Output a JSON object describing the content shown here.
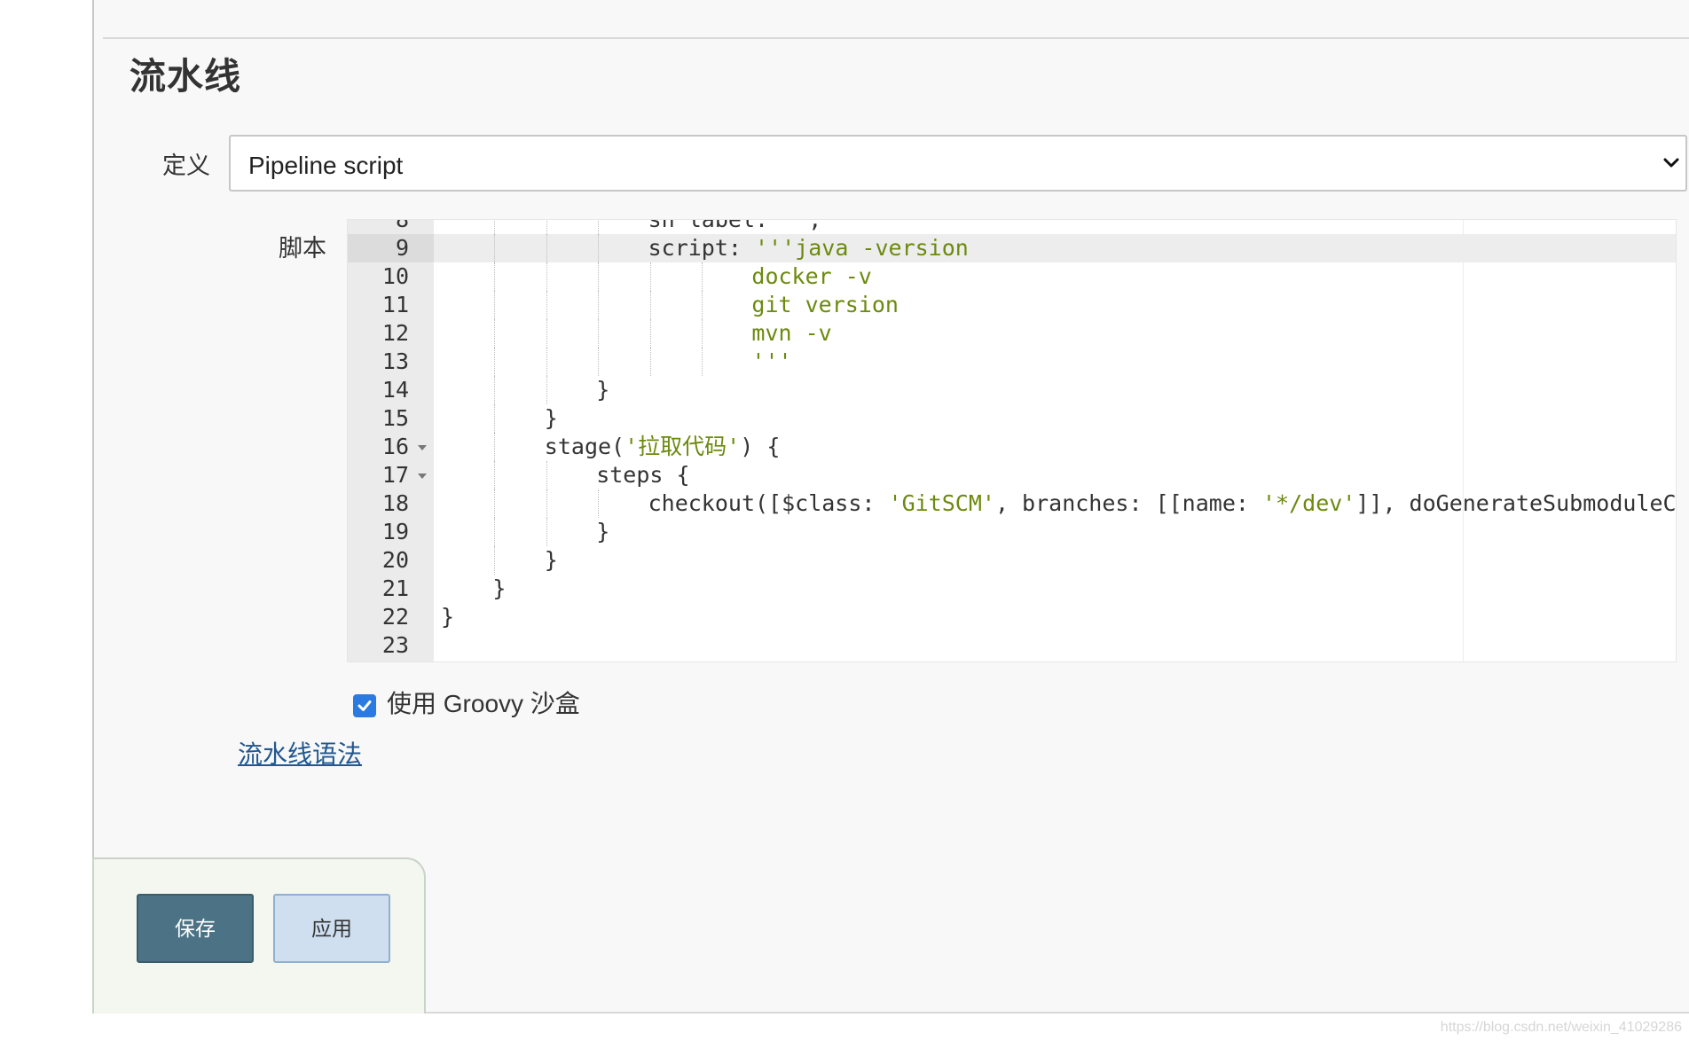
{
  "section": {
    "title": "流水线"
  },
  "definition": {
    "label": "定义",
    "selected": "Pipeline script"
  },
  "script": {
    "label": "脚本",
    "lines": [
      {
        "n": "8",
        "indent": 0,
        "guides": [
          3,
          4,
          5
        ],
        "parts": [
          [
            "sh label: '',",
            ""
          ]
        ],
        "fold": false,
        "partial": true
      },
      {
        "n": "9",
        "indent": 0,
        "guides": [
          3,
          4,
          5
        ],
        "parts": [
          [
            "script: ",
            ""
          ],
          [
            "'''java -version",
            "str"
          ]
        ],
        "fold": false,
        "active": true
      },
      {
        "n": "10",
        "indent": 0,
        "guides": [
          3,
          4,
          5,
          6,
          7
        ],
        "parts": [
          [
            "docker -v",
            "str"
          ]
        ],
        "fold": false
      },
      {
        "n": "11",
        "indent": 0,
        "guides": [
          3,
          4,
          5,
          6,
          7
        ],
        "parts": [
          [
            "git version",
            "str"
          ]
        ],
        "fold": false
      },
      {
        "n": "12",
        "indent": 0,
        "guides": [
          3,
          4,
          5,
          6,
          7
        ],
        "parts": [
          [
            "mvn -v",
            "str"
          ]
        ],
        "fold": false
      },
      {
        "n": "13",
        "indent": 0,
        "guides": [
          3,
          4,
          5,
          6,
          7
        ],
        "parts": [
          [
            "'''",
            "str"
          ]
        ],
        "fold": false
      },
      {
        "n": "14",
        "indent": 0,
        "guides": [
          3,
          4
        ],
        "parts": [
          [
            "}",
            ""
          ]
        ],
        "fold": false
      },
      {
        "n": "15",
        "indent": 0,
        "guides": [
          3
        ],
        "parts": [
          [
            "}",
            ""
          ]
        ],
        "fold": false
      },
      {
        "n": "16",
        "indent": 0,
        "guides": [
          3
        ],
        "parts": [
          [
            "stage(",
            ""
          ],
          [
            "'拉取代码'",
            "str"
          ],
          [
            ") {",
            ""
          ]
        ],
        "fold": true
      },
      {
        "n": "17",
        "indent": 0,
        "guides": [
          3,
          4
        ],
        "parts": [
          [
            "steps {",
            ""
          ]
        ],
        "fold": true
      },
      {
        "n": "18",
        "indent": 0,
        "guides": [
          3,
          4,
          5
        ],
        "parts": [
          [
            "checkout([$class: ",
            ""
          ],
          [
            "'GitSCM'",
            "str"
          ],
          [
            ", branches: [[name: ",
            ""
          ],
          [
            "'*/dev'",
            "str"
          ],
          [
            "]], doGenerateSubmoduleConfi",
            ""
          ]
        ],
        "fold": false
      },
      {
        "n": "19",
        "indent": 0,
        "guides": [
          3,
          4
        ],
        "parts": [
          [
            "}",
            ""
          ]
        ],
        "fold": false
      },
      {
        "n": "20",
        "indent": 0,
        "guides": [
          3
        ],
        "parts": [
          [
            "}",
            ""
          ]
        ],
        "fold": false
      },
      {
        "n": "21",
        "indent": 0,
        "guides": [],
        "parts": [
          [
            "}",
            ""
          ]
        ],
        "fold": false
      },
      {
        "n": "22",
        "indent": 0,
        "guides": [],
        "parts": [
          [
            "}",
            ""
          ]
        ],
        "fold": false
      },
      {
        "n": "23",
        "indent": 0,
        "guides": [],
        "parts": [
          [
            "",
            ""
          ]
        ],
        "fold": false
      }
    ],
    "columns": [
      {
        "line": "8",
        "col": 16
      },
      {
        "line": "9",
        "col": 16
      },
      {
        "line": "10",
        "col": 24
      },
      {
        "line": "11",
        "col": 24
      },
      {
        "line": "12",
        "col": 24
      },
      {
        "line": "13",
        "col": 24
      },
      {
        "line": "14",
        "col": 12
      },
      {
        "line": "15",
        "col": 8
      },
      {
        "line": "16",
        "col": 8
      },
      {
        "line": "17",
        "col": 12
      },
      {
        "line": "18",
        "col": 16
      },
      {
        "line": "19",
        "col": 12
      },
      {
        "line": "20",
        "col": 8
      },
      {
        "line": "21",
        "col": 4
      },
      {
        "line": "22",
        "col": 0
      },
      {
        "line": "23",
        "col": 0
      }
    ]
  },
  "sandbox": {
    "label": "使用 Groovy 沙盒",
    "checked": true
  },
  "syntax_link": "流水线语法",
  "buttons": {
    "save": "保存",
    "apply": "应用"
  },
  "watermark": "https://blog.csdn.net/weixin_41029286"
}
